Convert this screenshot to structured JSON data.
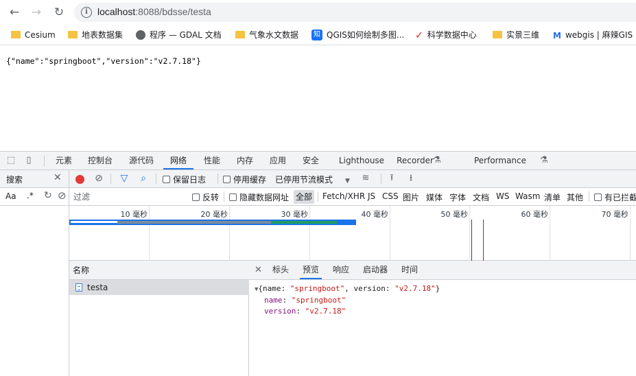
{
  "browser": {
    "url_host": "localhost",
    "url_rest": ":8088/bdsse/testa",
    "bookmarks": [
      {
        "label": "Cesium",
        "icon": "folder-icon"
      },
      {
        "label": "地表数据集",
        "icon": "folder-icon"
      },
      {
        "label": "程序 — GDAL 文档",
        "icon": "globe-icon"
      },
      {
        "label": "气象水文数据",
        "icon": "folder-icon"
      },
      {
        "label": "QGIS如何绘制多图...",
        "icon": "zhihu-icon",
        "icon_text": "知"
      },
      {
        "label": "科学数据中心",
        "icon": "logo-icon"
      },
      {
        "label": "实景三维",
        "icon": "folder-icon"
      },
      {
        "label": "webgis | 麻辣GIS",
        "icon": "logo-icon"
      }
    ]
  },
  "page": {
    "body_text": "{\"name\":\"springboot\",\"version\":\"v2.7.18\"}"
  },
  "devtools": {
    "tabs": [
      "元素",
      "控制台",
      "源代码",
      "网络",
      "性能",
      "内存",
      "应用",
      "安全",
      "Lighthouse",
      "Recorder",
      "Performance insights"
    ],
    "active_tab": "网络",
    "search_label": "搜索",
    "toolbar": {
      "preserve_log": "保留日志",
      "disable_cache": "停用缓存",
      "throttling": "已停用节流模式"
    },
    "filter": {
      "aa": "Aa",
      "regex": ".*",
      "placeholder": "过滤",
      "invert": "反转",
      "hide_data_urls": "隐藏数据网址",
      "types": [
        "全部",
        "Fetch/XHR",
        "JS",
        "CSS",
        "图片",
        "媒体",
        "字体",
        "文档",
        "WS",
        "Wasm",
        "清单",
        "其他"
      ],
      "blocked": "有已拦截"
    },
    "timeline_ticks": [
      "10 毫秒",
      "20 毫秒",
      "30 毫秒",
      "40 毫秒",
      "50 毫秒",
      "60 毫秒",
      "70 毫秒"
    ],
    "requests_header": "名称",
    "requests": [
      "testa"
    ],
    "detail_tabs": [
      "标头",
      "预览",
      "响应",
      "启动器",
      "时间"
    ],
    "active_detail_tab": "预览",
    "preview": {
      "summary_prefix": "{",
      "summary_name_key": "name",
      "summary_name_val": "\"springboot\"",
      "summary_version_key": "version",
      "summary_version_val": "\"v2.7.18\"",
      "summary_suffix": "}",
      "name_key": "name",
      "name_val": "\"springboot\"",
      "version_key": "version",
      "version_val": "\"v2.7.18\""
    },
    "colors": {
      "accent": "#1a73e8",
      "record": "#e53935",
      "string": "#c41a16",
      "key": "#881280"
    }
  }
}
